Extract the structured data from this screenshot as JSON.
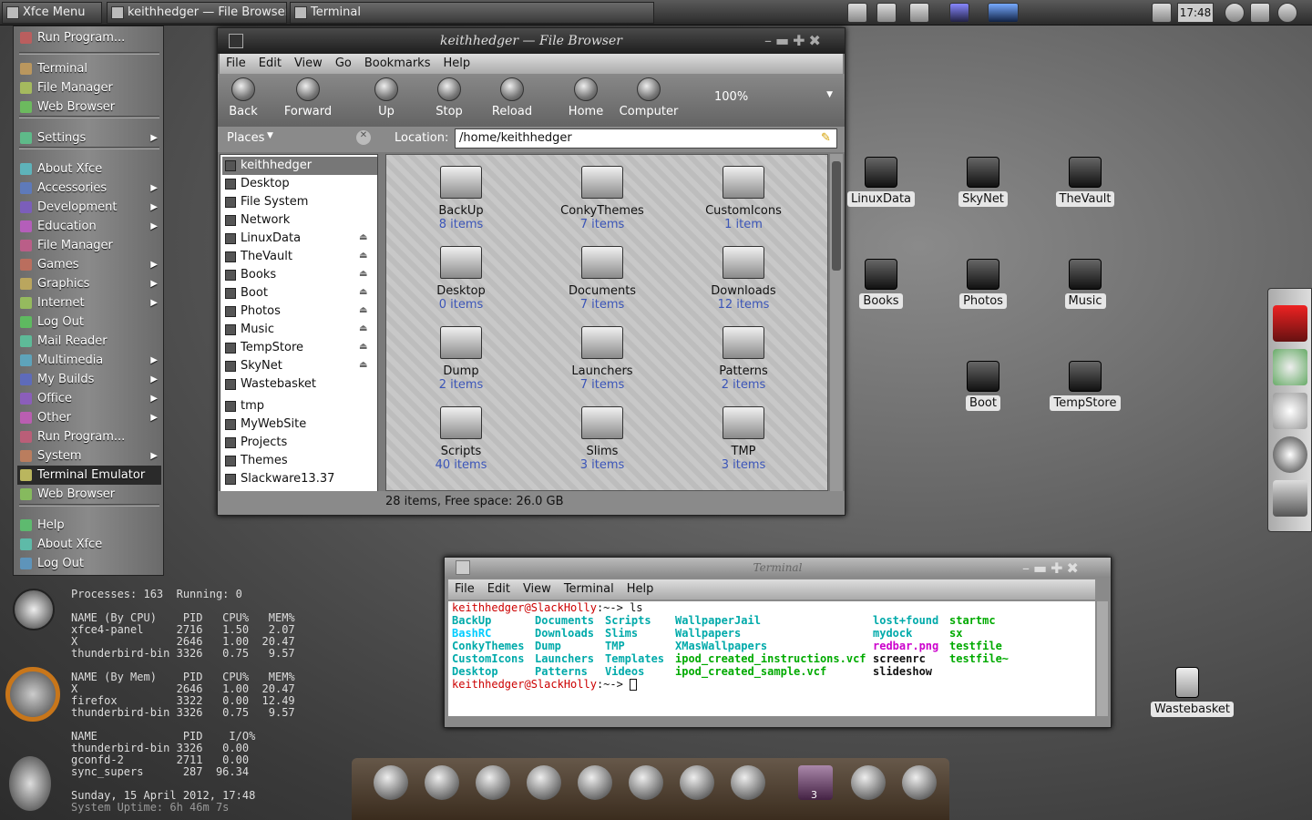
{
  "panel": {
    "menu_label": "Xfce Menu",
    "tasks": [
      "keithhedger — File Browser",
      "Terminal"
    ],
    "clock": "17:48"
  },
  "menu": {
    "items": [
      {
        "label": "Run Program...",
        "icon": "run-icon",
        "arrow": false
      },
      {
        "label": "Terminal",
        "icon": "terminal-icon",
        "arrow": false
      },
      {
        "label": "File Manager",
        "icon": "folder-icon",
        "arrow": false
      },
      {
        "label": "Web Browser",
        "icon": "globe-icon",
        "arrow": false
      },
      {
        "label": "Settings",
        "icon": "settings-icon",
        "arrow": true
      },
      {
        "label": "About Xfce",
        "icon": "info-icon",
        "arrow": false
      },
      {
        "label": "Accessories",
        "icon": "accessories-icon",
        "arrow": true
      },
      {
        "label": "Development",
        "icon": "development-icon",
        "arrow": true
      },
      {
        "label": "Education",
        "icon": "education-icon",
        "arrow": true
      },
      {
        "label": "File Manager",
        "icon": "folder-icon",
        "arrow": false
      },
      {
        "label": "Games",
        "icon": "games-icon",
        "arrow": true
      },
      {
        "label": "Graphics",
        "icon": "graphics-icon",
        "arrow": true
      },
      {
        "label": "Internet",
        "icon": "internet-icon",
        "arrow": true
      },
      {
        "label": "Log Out",
        "icon": "logout-icon",
        "arrow": false
      },
      {
        "label": "Mail Reader",
        "icon": "mail-icon",
        "arrow": false
      },
      {
        "label": "Multimedia",
        "icon": "multimedia-icon",
        "arrow": true
      },
      {
        "label": "My Builds",
        "icon": "builds-icon",
        "arrow": true
      },
      {
        "label": "Office",
        "icon": "office-icon",
        "arrow": true
      },
      {
        "label": "Other",
        "icon": "other-icon",
        "arrow": true
      },
      {
        "label": "Run Program...",
        "icon": "run-icon",
        "arrow": false
      },
      {
        "label": "System",
        "icon": "system-icon",
        "arrow": true
      },
      {
        "label": "Terminal Emulator",
        "icon": "terminal-icon",
        "arrow": false
      },
      {
        "label": "Web Browser",
        "icon": "globe-icon",
        "arrow": false
      },
      {
        "label": "Help",
        "icon": "help-icon",
        "arrow": false
      },
      {
        "label": "About Xfce",
        "icon": "info-icon",
        "arrow": false
      },
      {
        "label": "Log Out",
        "icon": "logout-icon",
        "arrow": false
      }
    ]
  },
  "fb": {
    "title": "keithhedger — File Browser",
    "menus": [
      "File",
      "Edit",
      "View",
      "Go",
      "Bookmarks",
      "Help"
    ],
    "toolbar": [
      "Back",
      "Forward",
      "Up",
      "Stop",
      "Reload",
      "Home",
      "Computer"
    ],
    "zoom": "100%",
    "places_label": "Places",
    "location_label": "Location:",
    "location": "/home/keithhedger",
    "places": [
      {
        "label": "keithhedger",
        "eject": false
      },
      {
        "label": "Desktop",
        "eject": false
      },
      {
        "label": "File System",
        "eject": false
      },
      {
        "label": "Network",
        "eject": false
      },
      {
        "label": "LinuxData",
        "eject": true
      },
      {
        "label": "TheVault",
        "eject": true
      },
      {
        "label": "Books",
        "eject": true
      },
      {
        "label": "Boot",
        "eject": true
      },
      {
        "label": "Photos",
        "eject": true
      },
      {
        "label": "Music",
        "eject": true
      },
      {
        "label": "TempStore",
        "eject": true
      },
      {
        "label": "SkyNet",
        "eject": true
      },
      {
        "label": "Wastebasket",
        "eject": false
      },
      {
        "label": "tmp",
        "eject": false
      },
      {
        "label": "MyWebSite",
        "eject": false
      },
      {
        "label": "Projects",
        "eject": false
      },
      {
        "label": "Themes",
        "eject": false
      },
      {
        "label": "Slackware13.37",
        "eject": false
      }
    ],
    "files": [
      {
        "name": "BackUp",
        "count": "8 items"
      },
      {
        "name": "ConkyThemes",
        "count": "7 items"
      },
      {
        "name": "CustomIcons",
        "count": "1 item"
      },
      {
        "name": "Desktop",
        "count": "0 items"
      },
      {
        "name": "Documents",
        "count": "7 items"
      },
      {
        "name": "Downloads",
        "count": "12 items"
      },
      {
        "name": "Dump",
        "count": "2 items"
      },
      {
        "name": "Launchers",
        "count": "7 items"
      },
      {
        "name": "Patterns",
        "count": "2 items"
      },
      {
        "name": "Scripts",
        "count": "40 items"
      },
      {
        "name": "Slims",
        "count": "3 items"
      },
      {
        "name": "TMP",
        "count": "3 items"
      }
    ],
    "status": "28 items, Free space: 26.0 GB"
  },
  "desktop": {
    "icons": [
      "LinuxData",
      "SkyNet",
      "TheVault",
      "Books",
      "Photos",
      "Music",
      "Boot",
      "TempStore",
      "Wastebasket"
    ]
  },
  "term": {
    "title": "Terminal",
    "menus": [
      "File",
      "Edit",
      "View",
      "Terminal",
      "Help"
    ],
    "prompt": "keithhedger@SlackHolly",
    "prompt_suffix": ":~-> ls",
    "prompt_suffix2": ":~-> ",
    "cols": [
      [
        "BackUp",
        "BashRC",
        "ConkyThemes",
        "CustomIcons",
        "Desktop"
      ],
      [
        "Documents",
        "Downloads",
        "Dump",
        "Launchers",
        "Patterns"
      ],
      [
        "Scripts",
        "Slims",
        "TMP",
        "Templates",
        "Videos"
      ],
      [
        "WallpaperJail",
        "Wallpapers",
        "XMasWallpapers",
        "ipod_created_instructions.vcf",
        "ipod_created_sample.vcf"
      ],
      [
        "lost+found",
        "mydock",
        "redbar.png",
        "screenrc",
        "slideshow"
      ],
      [
        "startmc",
        "sx",
        "testfile",
        "testfile~",
        ""
      ]
    ]
  },
  "conky": {
    "lines": [
      "Processes: 163  Running: 0",
      "",
      "NAME (By CPU)    PID   CPU%   MEM%",
      "xfce4-panel     2716   1.50   2.07",
      "X               2646   1.00  20.47",
      "thunderbird-bin 3326   0.75   9.57",
      "",
      "NAME (By Mem)    PID   CPU%   MEM%",
      "X               2646   1.00  20.47",
      "firefox         3322   0.00  12.49",
      "thunderbird-bin 3326   0.75   9.57",
      "",
      "NAME             PID    I/O%",
      "thunderbird-bin 3326   0.00",
      "gconfd-2        2711   0.00",
      "sync_supers      287  96.34",
      "",
      "Sunday, 15 April 2012, 17:48",
      "System Uptime: 6h 46m 7s"
    ]
  },
  "dock": {
    "badge": "3"
  }
}
